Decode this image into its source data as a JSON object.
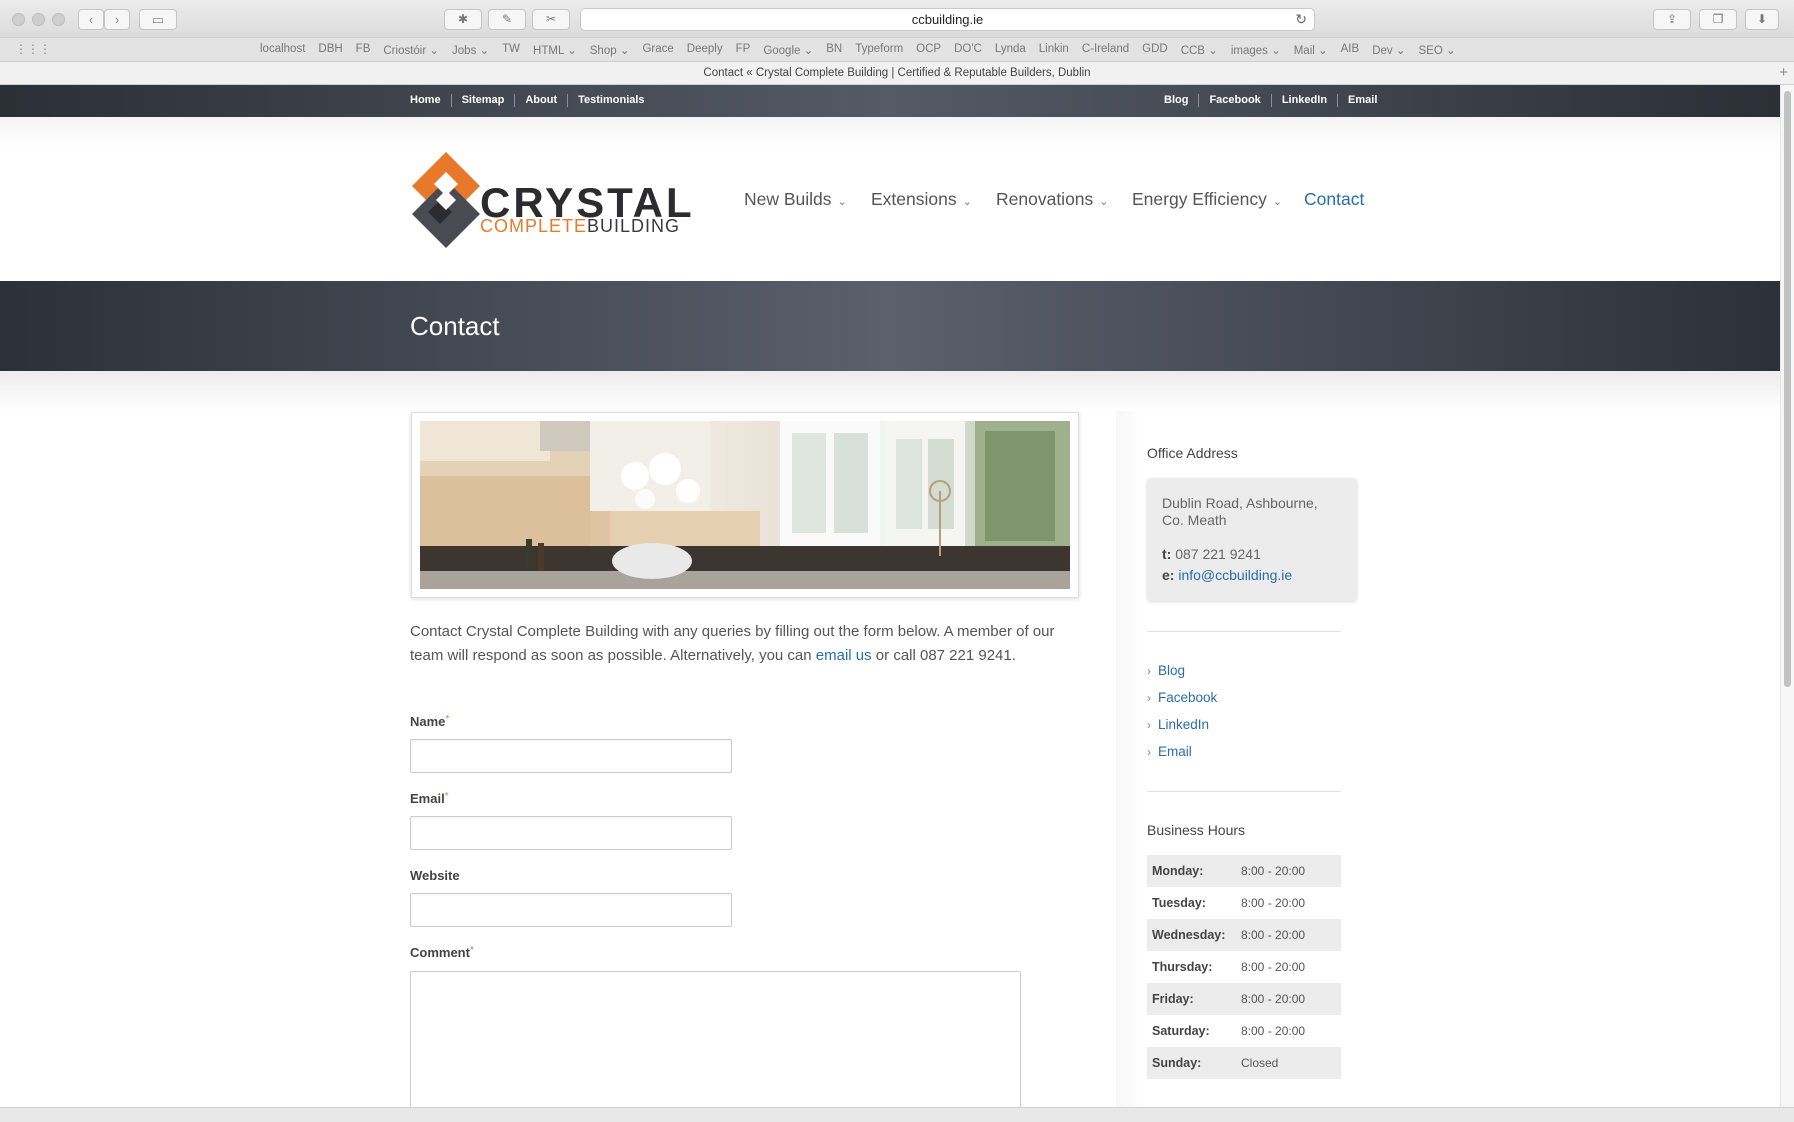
{
  "browser": {
    "url": "ccbuilding.ie",
    "tab_title": "Contact « Crystal Complete Building | Certified & Reputable Builders, Dublin",
    "bookmarks": [
      "localhost",
      "DBH",
      "FB",
      "Criostóir ⌄",
      "Jobs ⌄",
      "TW",
      "HTML ⌄",
      "Shop ⌄",
      "Grace",
      "Deeply",
      "FP",
      "Google ⌄",
      "BN",
      "Typeform",
      "OCP",
      "DO'C",
      "Lynda",
      "Linkin",
      "C-Ireland",
      "GDD",
      "CCB ⌄",
      "images ⌄",
      "Mail ⌄",
      "AIB",
      "Dev ⌄",
      "SEO ⌄"
    ]
  },
  "topbar": {
    "left": [
      "Home",
      "Sitemap",
      "About",
      "Testimonials"
    ],
    "right": [
      "Blog",
      "Facebook",
      "LinkedIn",
      "Email"
    ]
  },
  "logo": {
    "word": "CRYSTAL",
    "sub_orange": "COMPLETE",
    "sub_dark": "BUILDING"
  },
  "nav": {
    "new_builds": "New Builds",
    "extensions": "Extensions",
    "renovations": "Renovations",
    "energy": "Energy Efficiency",
    "contact": "Contact",
    "chevron": "⌄"
  },
  "page": {
    "title": "Contact",
    "intro_1": "Contact Crystal Complete Building with any queries by filling out the form below. A member of our team will respond as soon as possible. Alternatively, you can ",
    "intro_link": "email us",
    "intro_2": " or call 087 221 9241."
  },
  "form": {
    "name_label": "Name",
    "email_label": "Email",
    "website_label": "Website",
    "comment_label": "Comment",
    "required_mark": "*"
  },
  "sidebar": {
    "office_heading": "Office Address",
    "address_1": "Dublin Road, Ashbourne,",
    "address_2": "Co. Meath",
    "phone_prefix": "t:",
    "phone": "087 221 9241",
    "email_prefix": "e:",
    "email": "info@ccbuilding.ie",
    "links": [
      "Blog",
      "Facebook",
      "LinkedIn",
      "Email"
    ],
    "hours_heading": "Business Hours",
    "hours": [
      {
        "day": "Monday:",
        "time": "8:00 - 20:00"
      },
      {
        "day": "Tuesday:",
        "time": "8:00 - 20:00"
      },
      {
        "day": "Wednesday:",
        "time": "8:00 - 20:00"
      },
      {
        "day": "Thursday:",
        "time": "8:00 - 20:00"
      },
      {
        "day": "Friday:",
        "time": "8:00 - 20:00"
      },
      {
        "day": "Saturday:",
        "time": "8:00 - 20:00"
      },
      {
        "day": "Sunday:",
        "time": "Closed"
      }
    ]
  },
  "colors": {
    "accent": "#2a6da8",
    "brand_orange": "#e8792a",
    "bar_dark": "#2c3038"
  }
}
